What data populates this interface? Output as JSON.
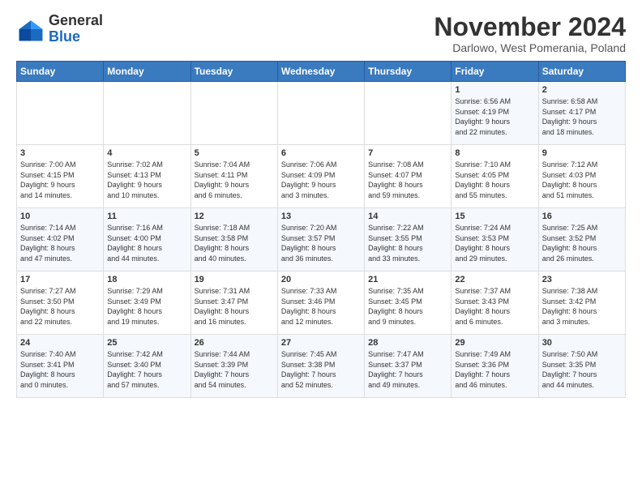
{
  "logo": {
    "general": "General",
    "blue": "Blue"
  },
  "title": "November 2024",
  "subtitle": "Darlowo, West Pomerania, Poland",
  "days_header": [
    "Sunday",
    "Monday",
    "Tuesday",
    "Wednesday",
    "Thursday",
    "Friday",
    "Saturday"
  ],
  "weeks": [
    [
      {
        "day": "",
        "info": ""
      },
      {
        "day": "",
        "info": ""
      },
      {
        "day": "",
        "info": ""
      },
      {
        "day": "",
        "info": ""
      },
      {
        "day": "",
        "info": ""
      },
      {
        "day": "1",
        "info": "Sunrise: 6:56 AM\nSunset: 4:19 PM\nDaylight: 9 hours\nand 22 minutes."
      },
      {
        "day": "2",
        "info": "Sunrise: 6:58 AM\nSunset: 4:17 PM\nDaylight: 9 hours\nand 18 minutes."
      }
    ],
    [
      {
        "day": "3",
        "info": "Sunrise: 7:00 AM\nSunset: 4:15 PM\nDaylight: 9 hours\nand 14 minutes."
      },
      {
        "day": "4",
        "info": "Sunrise: 7:02 AM\nSunset: 4:13 PM\nDaylight: 9 hours\nand 10 minutes."
      },
      {
        "day": "5",
        "info": "Sunrise: 7:04 AM\nSunset: 4:11 PM\nDaylight: 9 hours\nand 6 minutes."
      },
      {
        "day": "6",
        "info": "Sunrise: 7:06 AM\nSunset: 4:09 PM\nDaylight: 9 hours\nand 3 minutes."
      },
      {
        "day": "7",
        "info": "Sunrise: 7:08 AM\nSunset: 4:07 PM\nDaylight: 8 hours\nand 59 minutes."
      },
      {
        "day": "8",
        "info": "Sunrise: 7:10 AM\nSunset: 4:05 PM\nDaylight: 8 hours\nand 55 minutes."
      },
      {
        "day": "9",
        "info": "Sunrise: 7:12 AM\nSunset: 4:03 PM\nDaylight: 8 hours\nand 51 minutes."
      }
    ],
    [
      {
        "day": "10",
        "info": "Sunrise: 7:14 AM\nSunset: 4:02 PM\nDaylight: 8 hours\nand 47 minutes."
      },
      {
        "day": "11",
        "info": "Sunrise: 7:16 AM\nSunset: 4:00 PM\nDaylight: 8 hours\nand 44 minutes."
      },
      {
        "day": "12",
        "info": "Sunrise: 7:18 AM\nSunset: 3:58 PM\nDaylight: 8 hours\nand 40 minutes."
      },
      {
        "day": "13",
        "info": "Sunrise: 7:20 AM\nSunset: 3:57 PM\nDaylight: 8 hours\nand 36 minutes."
      },
      {
        "day": "14",
        "info": "Sunrise: 7:22 AM\nSunset: 3:55 PM\nDaylight: 8 hours\nand 33 minutes."
      },
      {
        "day": "15",
        "info": "Sunrise: 7:24 AM\nSunset: 3:53 PM\nDaylight: 8 hours\nand 29 minutes."
      },
      {
        "day": "16",
        "info": "Sunrise: 7:25 AM\nSunset: 3:52 PM\nDaylight: 8 hours\nand 26 minutes."
      }
    ],
    [
      {
        "day": "17",
        "info": "Sunrise: 7:27 AM\nSunset: 3:50 PM\nDaylight: 8 hours\nand 22 minutes."
      },
      {
        "day": "18",
        "info": "Sunrise: 7:29 AM\nSunset: 3:49 PM\nDaylight: 8 hours\nand 19 minutes."
      },
      {
        "day": "19",
        "info": "Sunrise: 7:31 AM\nSunset: 3:47 PM\nDaylight: 8 hours\nand 16 minutes."
      },
      {
        "day": "20",
        "info": "Sunrise: 7:33 AM\nSunset: 3:46 PM\nDaylight: 8 hours\nand 12 minutes."
      },
      {
        "day": "21",
        "info": "Sunrise: 7:35 AM\nSunset: 3:45 PM\nDaylight: 8 hours\nand 9 minutes."
      },
      {
        "day": "22",
        "info": "Sunrise: 7:37 AM\nSunset: 3:43 PM\nDaylight: 8 hours\nand 6 minutes."
      },
      {
        "day": "23",
        "info": "Sunrise: 7:38 AM\nSunset: 3:42 PM\nDaylight: 8 hours\nand 3 minutes."
      }
    ],
    [
      {
        "day": "24",
        "info": "Sunrise: 7:40 AM\nSunset: 3:41 PM\nDaylight: 8 hours\nand 0 minutes."
      },
      {
        "day": "25",
        "info": "Sunrise: 7:42 AM\nSunset: 3:40 PM\nDaylight: 7 hours\nand 57 minutes."
      },
      {
        "day": "26",
        "info": "Sunrise: 7:44 AM\nSunset: 3:39 PM\nDaylight: 7 hours\nand 54 minutes."
      },
      {
        "day": "27",
        "info": "Sunrise: 7:45 AM\nSunset: 3:38 PM\nDaylight: 7 hours\nand 52 minutes."
      },
      {
        "day": "28",
        "info": "Sunrise: 7:47 AM\nSunset: 3:37 PM\nDaylight: 7 hours\nand 49 minutes."
      },
      {
        "day": "29",
        "info": "Sunrise: 7:49 AM\nSunset: 3:36 PM\nDaylight: 7 hours\nand 46 minutes."
      },
      {
        "day": "30",
        "info": "Sunrise: 7:50 AM\nSunset: 3:35 PM\nDaylight: 7 hours\nand 44 minutes."
      }
    ]
  ]
}
